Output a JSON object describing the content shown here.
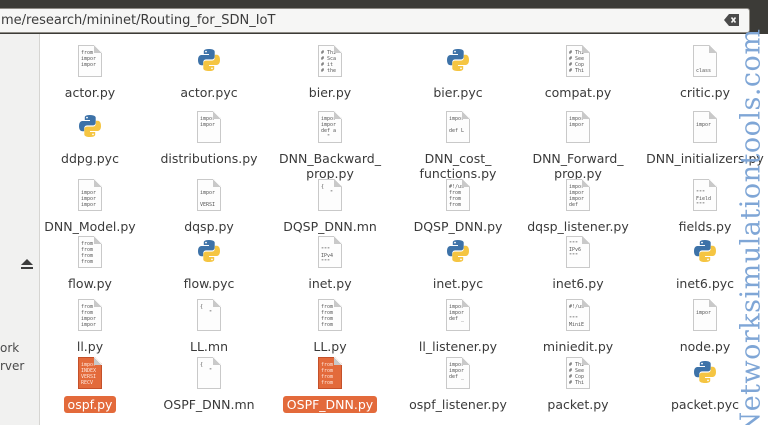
{
  "location": {
    "path": "me/research/mininet/Routing_for_SDN_IoT"
  },
  "icons": {
    "clear": "backspace-clear-icon",
    "eject": "eject-icon",
    "python": "python-logo-icon",
    "text": "text-file-icon"
  },
  "sidebar": {
    "labels": [
      "ork",
      "rver"
    ]
  },
  "watermark": "Networksimulationtools.com",
  "files": [
    {
      "name": "actor.py",
      "type": "text",
      "lines": [
        "from",
        "impor",
        "impor"
      ]
    },
    {
      "name": "actor.pyc",
      "type": "python"
    },
    {
      "name": "bier.py",
      "type": "text",
      "lines": [
        "# Thi",
        "# Sca",
        "# it",
        "# the"
      ]
    },
    {
      "name": "bier.pyc",
      "type": "python"
    },
    {
      "name": "compat.py",
      "type": "text",
      "lines": [
        "# Thi",
        "# See",
        "# Cop",
        "# Thi"
      ]
    },
    {
      "name": "critic.py",
      "type": "text",
      "lines": [
        "",
        "",
        "",
        "class"
      ]
    },
    {
      "name": "ddpg.pyc",
      "type": "python"
    },
    {
      "name": "distributions.py",
      "type": "text",
      "lines": [
        "impor",
        "impor"
      ]
    },
    {
      "name": "DNN_Backward_\nprop.py",
      "type": "text",
      "lines": [
        "impor",
        "impor",
        "def a",
        "  \""
      ]
    },
    {
      "name": "DNN_cost_\nfunctions.py",
      "type": "text",
      "lines": [
        "impor",
        "",
        "def L"
      ]
    },
    {
      "name": "DNN_Forward_\nprop.py",
      "type": "text",
      "lines": [
        "impor",
        "impor"
      ]
    },
    {
      "name": "DNN_initializers.py",
      "type": "text",
      "lines": [
        "",
        "impor"
      ]
    },
    {
      "name": "DNN_Model.py",
      "type": "text",
      "lines": [
        "",
        "impor",
        "impor",
        "impor"
      ]
    },
    {
      "name": "dqsp.py",
      "type": "text",
      "lines": [
        "",
        "impor",
        "",
        "VERSI"
      ]
    },
    {
      "name": "DQSP_DNN.mn",
      "type": "text",
      "lines": [
        "{",
        "   \""
      ]
    },
    {
      "name": "DQSP_DNN.py",
      "type": "text",
      "lines": [
        "#!/us",
        "from",
        "from",
        "from"
      ]
    },
    {
      "name": "dqsp_listener.py",
      "type": "text",
      "lines": [
        "impor",
        "impor",
        "impor",
        "def"
      ]
    },
    {
      "name": "fields.py",
      "type": "text",
      "lines": [
        "",
        "\"\"\"",
        "Field",
        "\"\"\""
      ]
    },
    {
      "name": "flow.py",
      "type": "text",
      "lines": [
        "from",
        "from",
        "from",
        "from"
      ]
    },
    {
      "name": "flow.pyc",
      "type": "python"
    },
    {
      "name": "inet.py",
      "type": "text",
      "lines": [
        "",
        "\"\"\"",
        "IPv4",
        "\"\"\""
      ]
    },
    {
      "name": "inet.pyc",
      "type": "python"
    },
    {
      "name": "inet6.py",
      "type": "text",
      "lines": [
        "\"\"\"",
        "IPv6",
        "\"\"\""
      ]
    },
    {
      "name": "inet6.pyc",
      "type": "python"
    },
    {
      "name": "ll.py",
      "type": "text",
      "lines": [
        "from",
        "from",
        "impor",
        "impor"
      ]
    },
    {
      "name": "LL.mn",
      "type": "text",
      "lines": [
        "{",
        "   \""
      ]
    },
    {
      "name": "LL.py",
      "type": "text",
      "lines": [
        "from",
        "from",
        "from",
        "from"
      ]
    },
    {
      "name": "ll_listener.py",
      "type": "text",
      "lines": [
        "impor",
        "impor",
        "def _"
      ]
    },
    {
      "name": "miniedit.py",
      "type": "text",
      "lines": [
        "#!/us",
        "",
        "\"\"\"",
        "MiniE"
      ]
    },
    {
      "name": "node.py",
      "type": "text",
      "lines": [
        "",
        "impor"
      ]
    },
    {
      "name": "ospf.py",
      "type": "text",
      "selected": true,
      "lines": [
        "impor",
        "INDEX",
        "VERSI",
        "RECV"
      ]
    },
    {
      "name": "OSPF_DNN.mn",
      "type": "text",
      "lines": [
        "{",
        "   \""
      ]
    },
    {
      "name": "OSPF_DNN.py",
      "type": "text",
      "selected": true,
      "lines": [
        "from",
        "from",
        "from",
        "from"
      ]
    },
    {
      "name": "ospf_listener.py",
      "type": "text",
      "lines": [
        "impor",
        "impor",
        "def _"
      ]
    },
    {
      "name": "packet.py",
      "type": "text",
      "lines": [
        "# Thi",
        "# See",
        "# Cop",
        "# Thi"
      ]
    },
    {
      "name": "packet.pyc",
      "type": "python"
    }
  ]
}
